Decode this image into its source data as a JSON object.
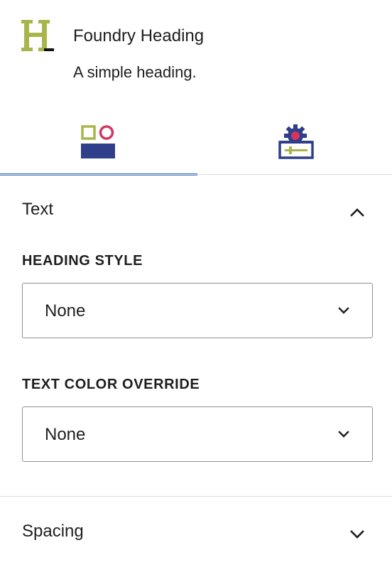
{
  "block": {
    "title": "Foundry Heading",
    "description": "A simple heading.",
    "icon": "heading-h-icon"
  },
  "tabs": [
    {
      "name": "styles-tab",
      "icon": "shapes-styles-icon",
      "active": true
    },
    {
      "name": "settings-tab",
      "icon": "gear-settings-icon",
      "active": false
    }
  ],
  "panels": {
    "text": {
      "title": "Text",
      "expanded": true,
      "heading_style": {
        "label": "HEADING STYLE",
        "value": "None"
      },
      "text_color_override": {
        "label": "TEXT COLOR OVERRIDE",
        "value": "None"
      }
    },
    "spacing": {
      "title": "Spacing",
      "expanded": false
    }
  },
  "colors": {
    "accent": "#3c7cc1",
    "icon_green": "#a9b54a",
    "icon_navy": "#2f3f8a",
    "icon_pink": "#d4355f"
  }
}
